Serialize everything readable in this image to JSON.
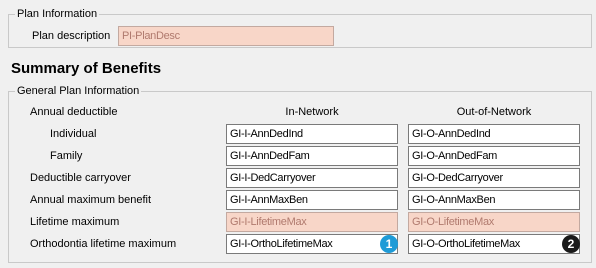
{
  "plan_info": {
    "legend": "Plan Information",
    "description_label": "Plan description",
    "description_value": "PI-PlanDesc"
  },
  "summary_title": "Summary of Benefits",
  "general": {
    "legend": "General Plan Information",
    "col_in_network": "In-Network",
    "col_out_network": "Out-of-Network",
    "rows": [
      {
        "label": "Annual deductible"
      },
      {
        "label": "Individual",
        "in": "GI-I-AnnDedInd",
        "out": "GI-O-AnnDedInd"
      },
      {
        "label": "Family",
        "in": "GI-I-AnnDedFam",
        "out": "GI-O-AnnDedFam"
      },
      {
        "label": "Deductible carryover",
        "in": "GI-I-DedCarryover",
        "out": "GI-O-DedCarryover"
      },
      {
        "label": "Annual maximum benefit",
        "in": "GI-I-AnnMaxBen",
        "out": "GI-O-AnnMaxBen"
      },
      {
        "label": "Lifetime maximum",
        "in": "GI-I-LifetimeMax",
        "out": "GI-O-LifetimeMax"
      },
      {
        "label": "Orthodontia lifetime maximum",
        "in": "GI-I-OrthoLifetimeMax",
        "out": "GI-O-OrthoLifetimeMax"
      }
    ]
  },
  "badges": {
    "one": "1",
    "two": "2",
    "one_color": "#1e9bd7",
    "two_color": "#1a1a1a"
  }
}
